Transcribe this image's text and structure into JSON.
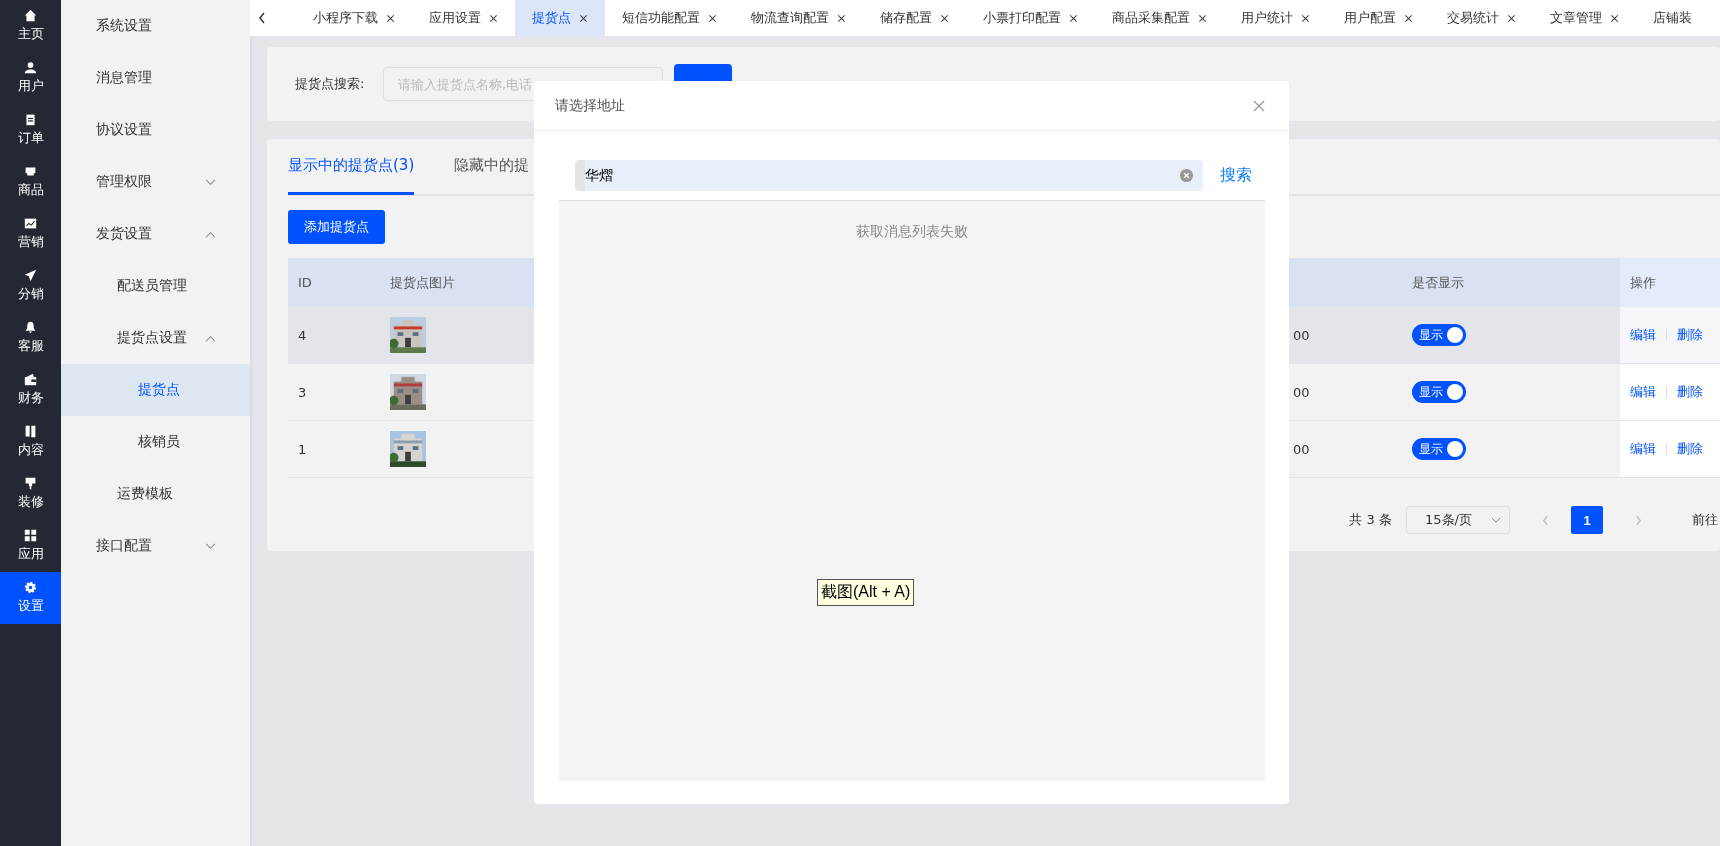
{
  "nav_rail": [
    {
      "label": "主页",
      "selected": false
    },
    {
      "label": "用户",
      "selected": false
    },
    {
      "label": "订单",
      "selected": false
    },
    {
      "label": "商品",
      "selected": false
    },
    {
      "label": "营销",
      "selected": false
    },
    {
      "label": "分销",
      "selected": false
    },
    {
      "label": "客服",
      "selected": false
    },
    {
      "label": "财务",
      "selected": false
    },
    {
      "label": "内容",
      "selected": false
    },
    {
      "label": "装修",
      "selected": false
    },
    {
      "label": "应用",
      "selected": false
    },
    {
      "label": "设置",
      "selected": true
    }
  ],
  "sidebar": {
    "items": [
      {
        "label": "系统设置",
        "selected": false
      },
      {
        "label": "消息管理",
        "selected": false
      },
      {
        "label": "协议设置",
        "selected": false
      },
      {
        "label": "管理权限",
        "selected": false,
        "expanded": false
      },
      {
        "label": "发货设置",
        "selected": false,
        "expanded": true,
        "children": [
          {
            "label": "配送员管理",
            "selected": false
          },
          {
            "label": "提货点设置",
            "selected": false,
            "expanded": true,
            "children": [
              {
                "label": "提货点",
                "selected": true
              },
              {
                "label": "核销员",
                "selected": false
              }
            ]
          },
          {
            "label": "运费模板",
            "selected": false
          }
        ]
      },
      {
        "label": "接口配置",
        "selected": false,
        "expanded": false
      }
    ]
  },
  "tabs": {
    "items": [
      {
        "label": "小程序下载",
        "selected": false,
        "closable": true
      },
      {
        "label": "应用设置",
        "selected": false,
        "closable": true
      },
      {
        "label": "提货点",
        "selected": true,
        "closable": true
      },
      {
        "label": "短信功能配置",
        "selected": false,
        "closable": true
      },
      {
        "label": "物流查询配置",
        "selected": false,
        "closable": true
      },
      {
        "label": "储存配置",
        "selected": false,
        "closable": true
      },
      {
        "label": "小票打印配置",
        "selected": false,
        "closable": true
      },
      {
        "label": "商品采集配置",
        "selected": false,
        "closable": true
      },
      {
        "label": "用户统计",
        "selected": false,
        "closable": true
      },
      {
        "label": "用户配置",
        "selected": false,
        "closable": true
      },
      {
        "label": "交易统计",
        "selected": false,
        "closable": true
      },
      {
        "label": "文章管理",
        "selected": false,
        "closable": true
      },
      {
        "label": "店铺装",
        "selected": false,
        "closable": false
      }
    ]
  },
  "search_panel": {
    "label": "提货点搜索:",
    "placeholder": "请输入提货点名称,电话"
  },
  "list_tabs": [
    {
      "label": "显示中的提货点(3)",
      "selected": true
    },
    {
      "label": "隐藏中的提",
      "selected": false
    }
  ],
  "add_button": "添加提货点",
  "table": {
    "columns": [
      {
        "label": "ID",
        "kind": "text"
      },
      {
        "label": "提货点图片",
        "kind": "picture"
      },
      {
        "kind": "text"
      },
      {
        "label": "是否显示",
        "kind": "toggle"
      },
      {
        "label": "操作",
        "kind": "actions"
      }
    ],
    "rows": [
      {
        "cells": [
          "4",
          null,
          "00",
          {
            "label": "显示",
            "on": true
          },
          [
            "编辑",
            "删除"
          ]
        ],
        "hovered": true
      },
      {
        "cells": [
          "3",
          null,
          "00",
          {
            "label": "显示",
            "on": true
          },
          [
            "编辑",
            "删除"
          ]
        ],
        "hovered": false
      },
      {
        "cells": [
          "1",
          null,
          "00",
          {
            "label": "显示",
            "on": true
          },
          [
            "编辑",
            "删除"
          ]
        ],
        "hovered": false
      }
    ]
  },
  "pagination": {
    "total": "共 3 条",
    "page_size": "15条/页",
    "pages": [
      {
        "label": "1",
        "selected": true
      }
    ],
    "goto": "前往"
  },
  "dialog": {
    "title": "请选择地址",
    "search": {
      "value": "华熠"
    },
    "search_button": "搜索",
    "message": "获取消息列表失败"
  },
  "tooltip": "截图(Alt + A)"
}
